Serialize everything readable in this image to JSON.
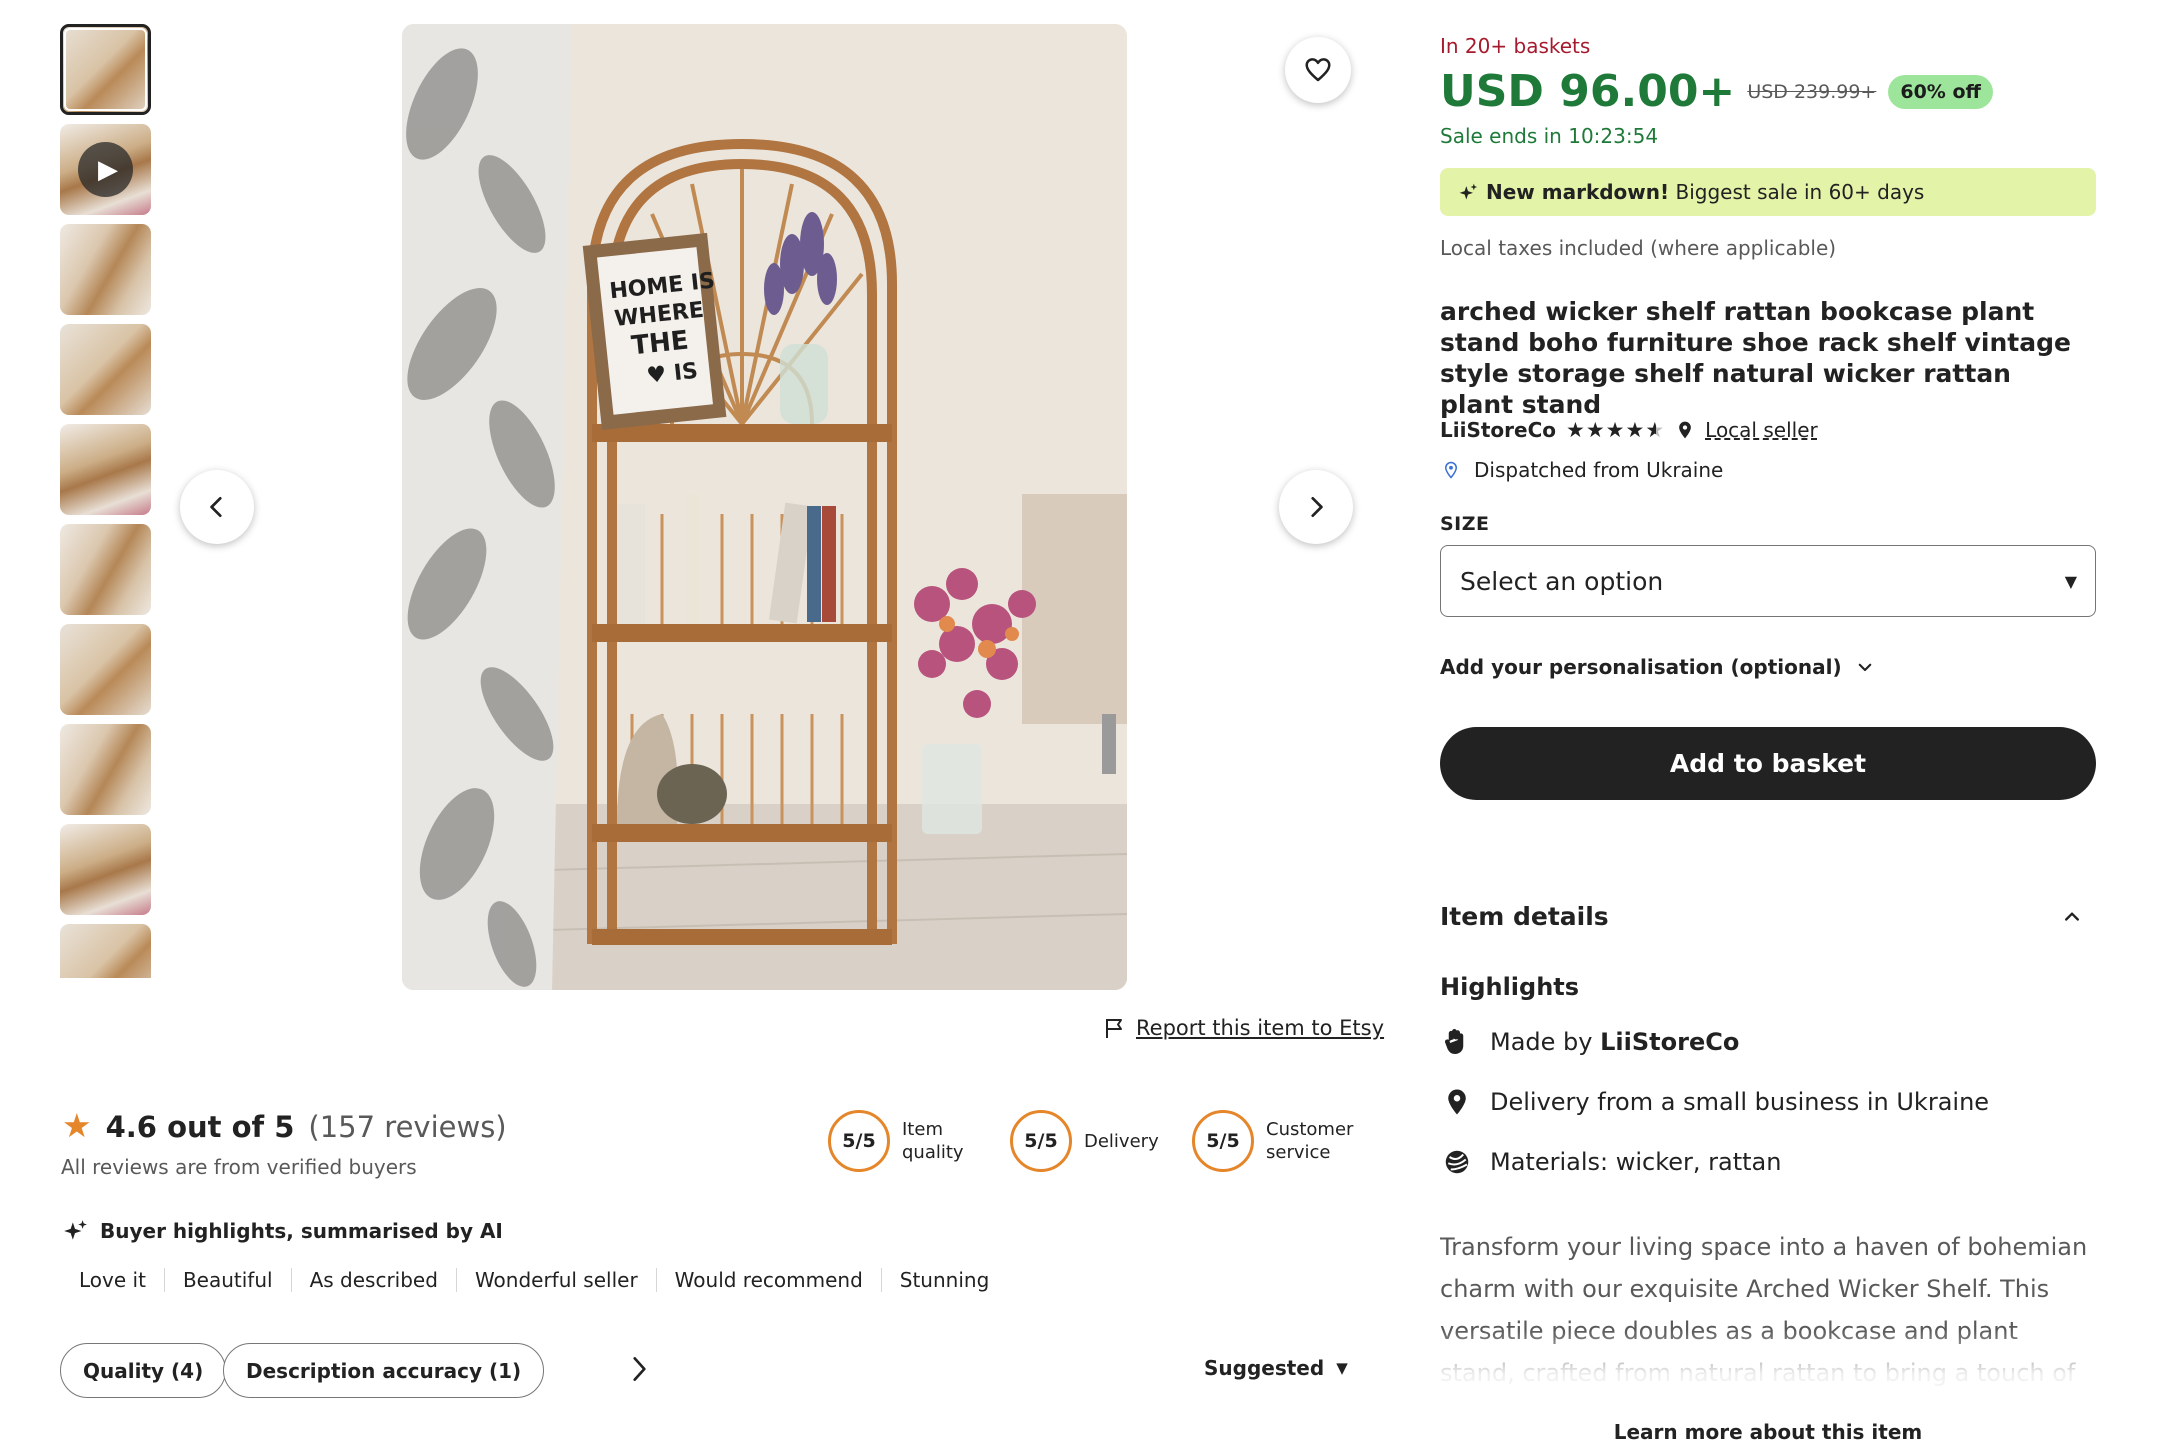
{
  "gallery": {
    "thumbnail_count": 10,
    "selected_index": 0,
    "has_video_thumb": true,
    "main_image_text": [
      "HOME IS",
      "WHERE",
      "THE",
      "IS"
    ]
  },
  "actions": {
    "report_label": "Report this item to Etsy"
  },
  "reviews": {
    "score_text": "4.6 out of 5",
    "count_text": "(157 reviews)",
    "verified_text": "All reviews are from verified buyers",
    "metrics": [
      {
        "score": "5/5",
        "label_line1": "Item",
        "label_line2": "quality"
      },
      {
        "score": "5/5",
        "label_line1": "Delivery",
        "label_line2": ""
      },
      {
        "score": "5/5",
        "label_line1": "Customer",
        "label_line2": "service"
      }
    ],
    "ai_title": "Buyer highlights, summarised by AI",
    "highlights": [
      "Love it",
      "Beautiful",
      "As described",
      "Wonderful seller",
      "Would recommend",
      "Stunning"
    ],
    "filters": [
      "Quality (4)",
      "Description accuracy (1)"
    ],
    "sort_label": "Suggested"
  },
  "listing": {
    "baskets_text": "In 20+ baskets",
    "price": "USD 96.00+",
    "old_price": "USD 239.99+",
    "discount": "60% off",
    "sale_ends": "Sale ends in 10:23:54",
    "markdown_bold": "New markdown!",
    "markdown_text": " Biggest sale in 60+ days",
    "taxes": "Local taxes included (where applicable)",
    "title": "arched wicker shelf rattan bookcase plant stand boho furniture shoe rack shelf vintage style storage shelf natural wicker rattan plant stand",
    "seller": "LiiStoreCo",
    "seller_rating": 4.5,
    "local_seller": "Local seller",
    "dispatched": "Dispatched from Ukraine",
    "size_label": "SIZE",
    "size_placeholder": "Select an option",
    "personalisation": "Add your personalisation (optional)",
    "add_to_basket": "Add to basket"
  },
  "item_details": {
    "header": "Item details",
    "highlights_title": "Highlights",
    "made_by_prefix": "Made by ",
    "made_by_seller": "LiiStoreCo",
    "delivery": "Delivery from a small business in Ukraine",
    "materials": "Materials: wicker, rattan",
    "description": "Transform your living space into a haven of bohemian charm with our exquisite Arched Wicker Shelf. This versatile piece doubles as a bookcase and plant stand, crafted from natural rattan to bring a touch of nature",
    "learn_more": "Learn more about this item"
  },
  "colors": {
    "price_green": "#1f7a3a",
    "discount_bg": "#9ee59c",
    "markdown_bg": "#e3f3a8",
    "basket_red": "#a61a2e",
    "rating_orange": "#e5862a",
    "button_dark": "#222222"
  }
}
